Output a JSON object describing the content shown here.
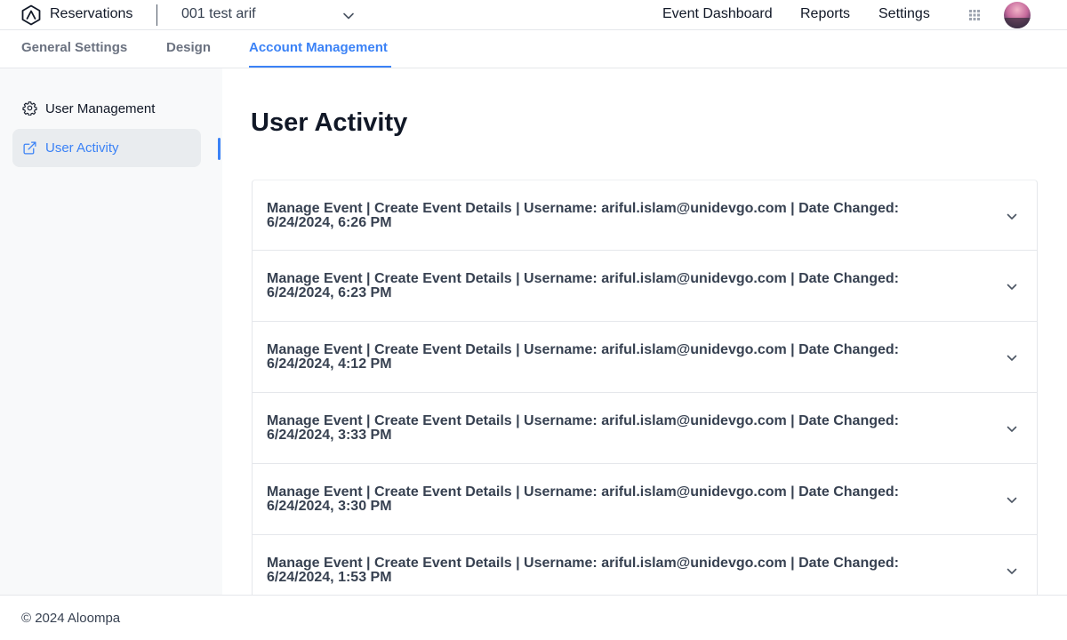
{
  "header": {
    "app_name": "Reservations",
    "selected_event": "001 test arif",
    "nav": [
      "Event Dashboard",
      "Reports",
      "Settings"
    ],
    "icons": [
      "logo-icon",
      "chevron-down-icon",
      "apps-grid-icon",
      "avatar"
    ]
  },
  "tabs": [
    {
      "label": "General Settings",
      "active": false
    },
    {
      "label": "Design",
      "active": false
    },
    {
      "label": "Account Management",
      "active": true
    }
  ],
  "sidebar": {
    "items": [
      {
        "label": "User Management",
        "icon": "gear-icon",
        "active": false
      },
      {
        "label": "User Activity",
        "icon": "external-link-icon",
        "active": true
      }
    ]
  },
  "main": {
    "title": "User Activity",
    "activities": [
      {
        "line1": "Manage Event | Create Event Details | Username: ariful.islam@unidevgo.com | Date Changed:",
        "line2": "6/24/2024, 6:26 PM"
      },
      {
        "line1": "Manage Event | Create Event Details | Username: ariful.islam@unidevgo.com | Date Changed:",
        "line2": "6/24/2024, 6:23 PM"
      },
      {
        "line1": "Manage Event | Create Event Details | Username: ariful.islam@unidevgo.com | Date Changed:",
        "line2": "6/24/2024, 4:12 PM"
      },
      {
        "line1": "Manage Event | Create Event Details | Username: ariful.islam@unidevgo.com | Date Changed:",
        "line2": "6/24/2024, 3:33 PM"
      },
      {
        "line1": "Manage Event | Create Event Details | Username: ariful.islam@unidevgo.com | Date Changed:",
        "line2": "6/24/2024, 3:30 PM"
      },
      {
        "line1": "Manage Event | Create Event Details | Username: ariful.islam@unidevgo.com | Date Changed:",
        "line2": "6/24/2024, 1:53 PM"
      }
    ]
  },
  "footer": {
    "copyright": "© 2024 Aloompa"
  },
  "colors": {
    "accent": "#3b82f6",
    "sidebar_bg": "#f8f9fa",
    "active_item_bg": "#e9ecef"
  }
}
